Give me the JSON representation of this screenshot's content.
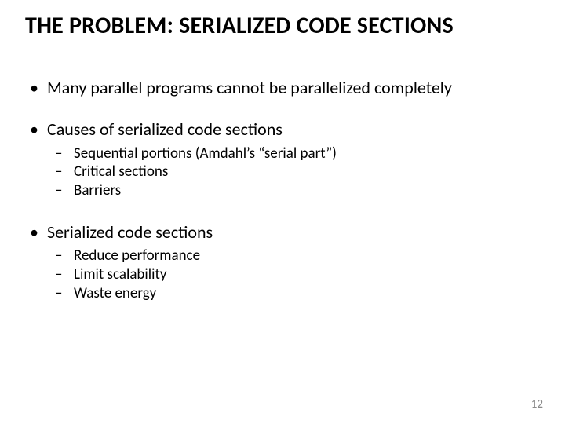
{
  "title": "THE PROBLEM: SERIALIZED CODE SECTIONS",
  "bullets": [
    {
      "text": "Many parallel programs cannot be parallelized completely",
      "sub": []
    },
    {
      "text": "Causes of serialized code sections",
      "sub": [
        "Sequential portions (Amdahl’s “serial part”)",
        "Critical sections",
        "Barriers"
      ]
    },
    {
      "text": "Serialized code sections",
      "sub": [
        "Reduce performance",
        "Limit scalability",
        "Waste energy"
      ]
    }
  ],
  "page_number": "12"
}
